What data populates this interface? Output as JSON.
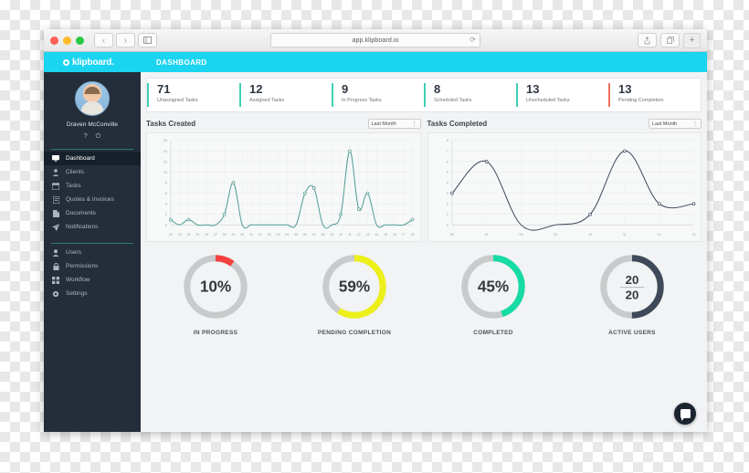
{
  "browser": {
    "url": "app.klipboard.io",
    "reload_icon": "reload-icon",
    "back_icon": "‹",
    "forward_icon": "›",
    "sidebar_icon": "sidebar-toggle-icon",
    "share_icon": "share-icon",
    "tabs_icon": "tabs-icon",
    "newtab_label": "+"
  },
  "topbar": {
    "brand": "klipboard.",
    "page_title": "DASHBOARD",
    "accent": "#1ad4f0"
  },
  "sidebar": {
    "user_name": "Draven McConville",
    "help_icon": "?",
    "power_icon": "⏻",
    "primary_items": [
      {
        "label": "Dashboard",
        "icon": "monitor-icon",
        "active": true
      },
      {
        "label": "Clients",
        "icon": "client-icon",
        "active": false
      },
      {
        "label": "Tasks",
        "icon": "calendar-icon",
        "active": false
      },
      {
        "label": "Quotes & Invoices",
        "icon": "invoice-icon",
        "active": false
      },
      {
        "label": "Documents",
        "icon": "document-icon",
        "active": false
      },
      {
        "label": "Notifications",
        "icon": "send-icon",
        "active": false
      }
    ],
    "secondary_items": [
      {
        "label": "Users",
        "icon": "user-icon"
      },
      {
        "label": "Permissions",
        "icon": "lock-icon"
      },
      {
        "label": "Workflow",
        "icon": "grid-icon"
      },
      {
        "label": "Settings",
        "icon": "gear-icon"
      }
    ]
  },
  "kpis": [
    {
      "value": "71",
      "label": "Unassigned Tasks",
      "color": "#3fcfb4"
    },
    {
      "value": "12",
      "label": "Assigned Tasks",
      "color": "#3fcfb4"
    },
    {
      "value": "9",
      "label": "In Progress Tasks",
      "color": "#3fcfb4"
    },
    {
      "value": "8",
      "label": "Scheduled Tasks",
      "color": "#3fcfb4"
    },
    {
      "value": "13",
      "label": "Unscheduled Tasks",
      "color": "#3fcfb4"
    },
    {
      "value": "13",
      "label": "Pending Completion",
      "color": "#f2705e"
    }
  ],
  "chart_panels": [
    {
      "title": "Tasks Created",
      "range_value": "Last Month"
    },
    {
      "title": "Tasks Completed",
      "range_value": "Last Month"
    }
  ],
  "chart_data": [
    {
      "type": "line",
      "title": "Tasks Created",
      "xlabel": "",
      "ylabel": "",
      "ylim": [
        0,
        16
      ],
      "yticks": [
        0,
        2,
        4,
        6,
        8,
        10,
        12,
        14,
        16
      ],
      "grid": true,
      "legend": "none",
      "line_color": "#4e9b93",
      "categories": [
        "22",
        "23",
        "24",
        "25",
        "26",
        "27",
        "28",
        "29",
        "30",
        "31",
        "01",
        "02",
        "03",
        "04",
        "05",
        "06",
        "07",
        "08",
        "09",
        "10",
        "11",
        "12",
        "13",
        "14",
        "15",
        "16",
        "17",
        "18"
      ],
      "values": [
        1,
        0,
        1,
        0,
        0,
        0,
        2,
        8,
        0,
        0,
        0,
        0,
        0,
        0,
        0,
        6,
        7,
        0,
        0,
        2,
        14,
        3,
        6,
        0,
        0,
        0,
        0,
        1
      ]
    },
    {
      "type": "line",
      "title": "Tasks Completed",
      "xlabel": "",
      "ylabel": "",
      "ylim": [
        0,
        8
      ],
      "yticks": [
        0,
        1,
        2,
        3,
        4,
        5,
        6,
        7,
        8
      ],
      "grid": true,
      "legend": "none",
      "line_color": "#3b4558",
      "categories": [
        "06",
        "07",
        "08",
        "09",
        "10",
        "11",
        "12",
        "13"
      ],
      "values": [
        3,
        6,
        0,
        0,
        1,
        7,
        2,
        2
      ]
    }
  ],
  "gauges": [
    {
      "value_text": "10%",
      "label": "IN PROGRESS",
      "percent": 10,
      "color": "#f4413f",
      "track": "#c8cacb"
    },
    {
      "value_text": "59%",
      "label": "PENDING COMPLETION",
      "percent": 59,
      "color": "#ecf018",
      "track": "#c8cacb"
    },
    {
      "value_text": "45%",
      "label": "COMPLETED",
      "percent": 45,
      "color": "#16dba4",
      "track": "#c8cacb"
    },
    {
      "numerator": "20",
      "denominator": "20",
      "label": "ACTIVE USERS",
      "percent": 50,
      "color": "#3e4a59",
      "track": "#c8cacb"
    }
  ],
  "chat": {
    "icon": "chat-bubble-icon"
  }
}
